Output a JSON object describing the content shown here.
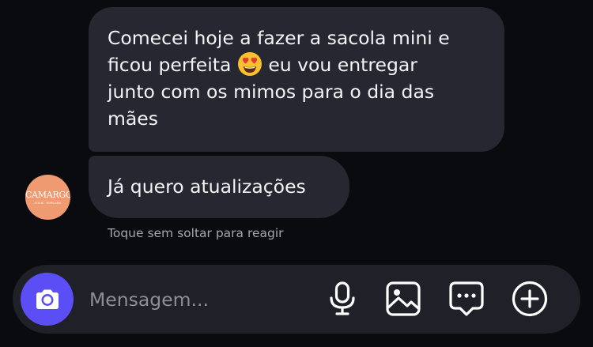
{
  "messages": [
    {
      "sender": "them",
      "text_before_emoji": "Comecei hoje a fazer a sacola mini e\nficou perfeita ",
      "emoji": "heart-eyes-emoji",
      "text_after_emoji": "  eu vou entregar\njunto com os mimos para o dia das\nmães"
    },
    {
      "sender": "them",
      "text": "Já quero atualizações"
    }
  ],
  "avatar": {
    "brand_text": "CAMARGO",
    "subtitle": "ATELIÊ · PAPELARIA",
    "color": "#f09a71"
  },
  "hint": "Toque sem soltar para reagir",
  "composer": {
    "placeholder": "Mensagem...",
    "camera_color": "#5b4ef5",
    "icons": [
      "camera-icon",
      "microphone-icon",
      "image-icon",
      "chat-dots-icon",
      "plus-circle-icon"
    ]
  },
  "colors": {
    "background": "#0a0b0f",
    "bubble": "#262730",
    "composer": "#1f2028",
    "accent": "#5b4ef5"
  }
}
